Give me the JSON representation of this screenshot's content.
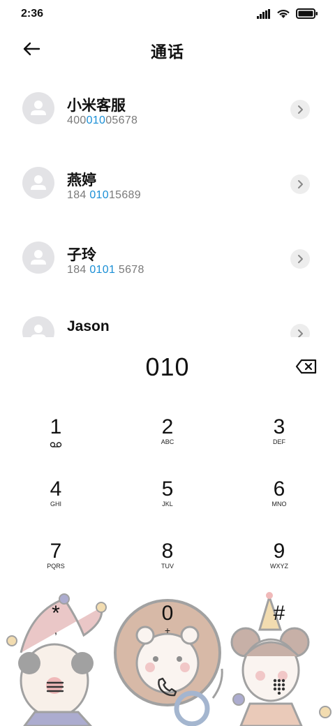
{
  "status": {
    "time": "2:36"
  },
  "header": {
    "title": "通话"
  },
  "contacts": [
    {
      "name": "小米客服",
      "num_pre": "400",
      "num_hl": "010",
      "num_post": "05678"
    },
    {
      "name": "燕婷",
      "num_pre": "184 ",
      "num_hl": "010",
      "num_post": "15689"
    },
    {
      "name": "子玲",
      "num_pre": "184 ",
      "num_hl": "0101",
      "num_post": " 5678"
    },
    {
      "name": "Jason",
      "num_pre": "",
      "num_hl": "",
      "num_post": ""
    }
  ],
  "dial": {
    "digits": "010"
  },
  "keypad": [
    {
      "digit": "1",
      "letters": ""
    },
    {
      "digit": "2",
      "letters": "ABC"
    },
    {
      "digit": "3",
      "letters": "DEF"
    },
    {
      "digit": "4",
      "letters": "GHI"
    },
    {
      "digit": "5",
      "letters": "JKL"
    },
    {
      "digit": "6",
      "letters": "MNO"
    },
    {
      "digit": "7",
      "letters": "PQRS"
    },
    {
      "digit": "8",
      "letters": "TUV"
    },
    {
      "digit": "9",
      "letters": "WXYZ"
    },
    {
      "digit": "*",
      "letters": ","
    },
    {
      "digit": "0",
      "letters": "+"
    },
    {
      "digit": "#",
      "letters": ""
    }
  ],
  "colors": {
    "highlight": "#1a8fd6",
    "avatar_bg": "#e3e3e6",
    "chevron_bg": "#ededed"
  },
  "icons": [
    "signal-icon",
    "wifi-icon",
    "battery-icon",
    "back-arrow-icon",
    "person-icon",
    "chevron-right-icon",
    "backspace-icon",
    "voicemail-icon",
    "menu-icon",
    "call-icon",
    "dialpad-icon"
  ]
}
